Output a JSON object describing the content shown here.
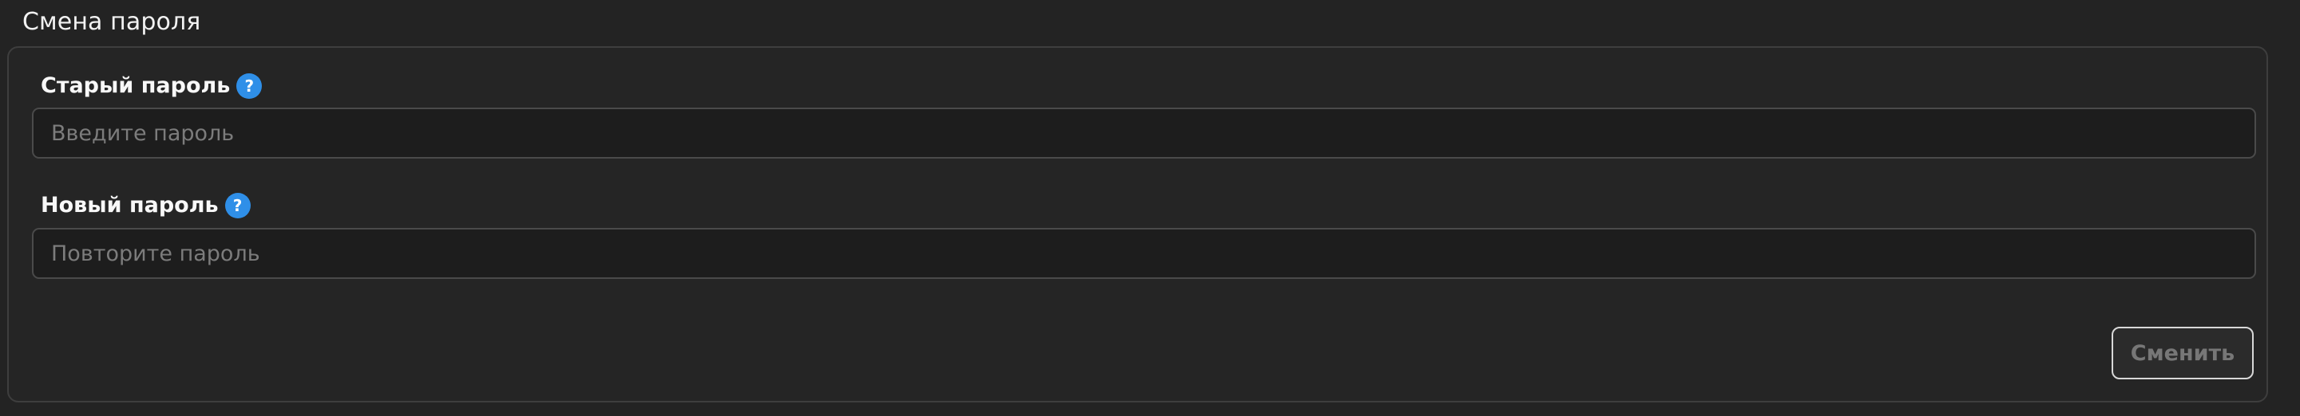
{
  "section": {
    "title": "Смена пароля"
  },
  "form": {
    "old_password": {
      "label": "Старый пароль",
      "help_icon": "question-mark",
      "value": "",
      "placeholder": "Введите пароль"
    },
    "new_password": {
      "label": "Новый пароль",
      "help_icon": "question-mark",
      "value": "",
      "placeholder": "Повторите пароль"
    },
    "submit_label": "Сменить"
  },
  "colors": {
    "background": "#232323",
    "card_border": "#3e3e3e",
    "input_background": "#1d1d1d",
    "help_accent": "#2f8fe8",
    "disabled_text": "#777777"
  }
}
